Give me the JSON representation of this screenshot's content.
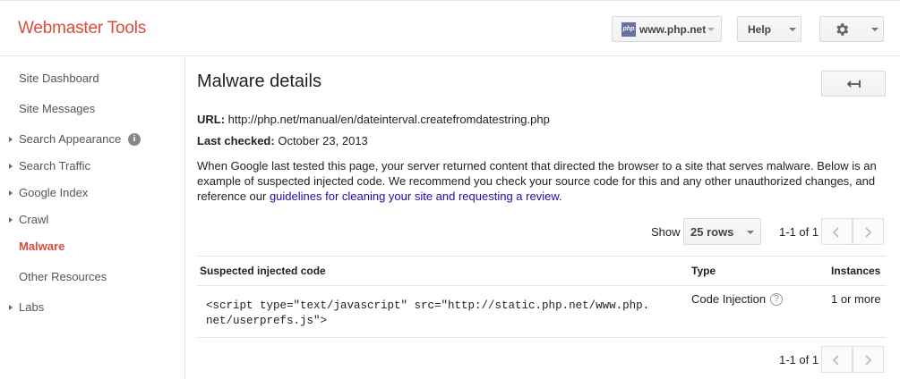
{
  "header": {
    "app_title": "Webmaster Tools",
    "site_selector": {
      "favicon_text": "php",
      "value": "www.php.net"
    },
    "help_label": "Help",
    "settings_icon": "gear-icon"
  },
  "sidebar": {
    "items": [
      {
        "label": "Site Dashboard",
        "expandable": false
      },
      {
        "label": "Site Messages",
        "expandable": false
      },
      {
        "label": "Search Appearance",
        "expandable": true,
        "info_icon": "i"
      },
      {
        "label": "Search Traffic",
        "expandable": true
      },
      {
        "label": "Google Index",
        "expandable": true
      },
      {
        "label": "Crawl",
        "expandable": true
      },
      {
        "label": "Malware",
        "expandable": false,
        "active": true
      },
      {
        "label": "Other Resources",
        "expandable": false
      },
      {
        "label": "Labs",
        "expandable": true
      }
    ]
  },
  "main": {
    "title": "Malware details",
    "url_label": "URL:",
    "url_value": "http://php.net/manual/en/dateinterval.createfromdatestring.php",
    "checked_label": "Last checked:",
    "checked_value": "October 23, 2013",
    "description": "When Google last tested this page, your server returned content that directed the browser to a site that serves malware. Below is an example of suspected injected code. We recommend you check your source code for this and any other unauthorized changes, and reference our",
    "guidelines_link": "guidelines for cleaning your site and requesting a review.",
    "show_label": "Show",
    "rows_value": "25 rows",
    "pager_top": "1-1 of 1",
    "pager_bottom": "1-1 of 1",
    "table": {
      "headers": [
        "Suspected injected code",
        "Type",
        "Instances"
      ],
      "rows": [
        {
          "code": "<script type=\"text/javascript\" src=\"http://static.php.net/www.php.net/userprefs.js\">",
          "type": "Code Injection",
          "type_help": "?",
          "instances": "1 or more"
        }
      ]
    }
  },
  "colors": {
    "brand_red": "#dd4b39",
    "link_blue": "#1a0dab",
    "border_gray": "#e5e5e5"
  }
}
